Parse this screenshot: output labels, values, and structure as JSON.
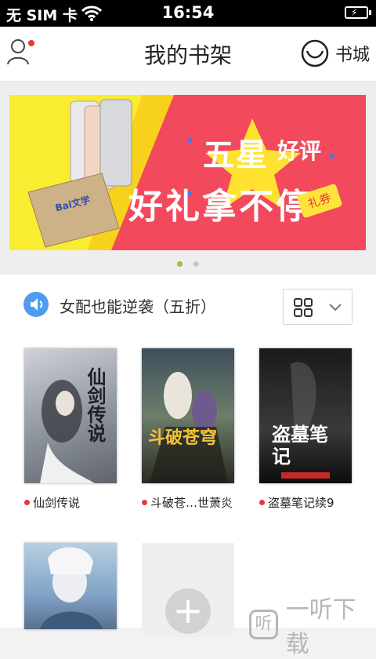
{
  "status_bar": {
    "carrier": "无 SIM 卡",
    "time": "16:54"
  },
  "header": {
    "title": "我的书架",
    "store_label": "书城"
  },
  "banner": {
    "line1": "五星",
    "line1b": "好评",
    "line2": "好礼拿不停",
    "coupon": "礼券",
    "brand": "Bai文学",
    "page_count": 2,
    "active_page": 1
  },
  "notice": {
    "text": "女配也能逆袭（五折）"
  },
  "books": [
    {
      "name": "仙剑传说",
      "cover_title": "仙剑传说"
    },
    {
      "name": "斗破苍…世萧炎",
      "cover_title": "斗破苍穹"
    },
    {
      "name": "盗墓笔记续9",
      "cover_title": "盗墓笔记"
    }
  ],
  "watermark": {
    "icon": "听",
    "text": "一听下载"
  },
  "colors": {
    "accent_red": "#e53935",
    "speaker_blue": "#4e9bef",
    "dot_active": "#9ac43a"
  }
}
